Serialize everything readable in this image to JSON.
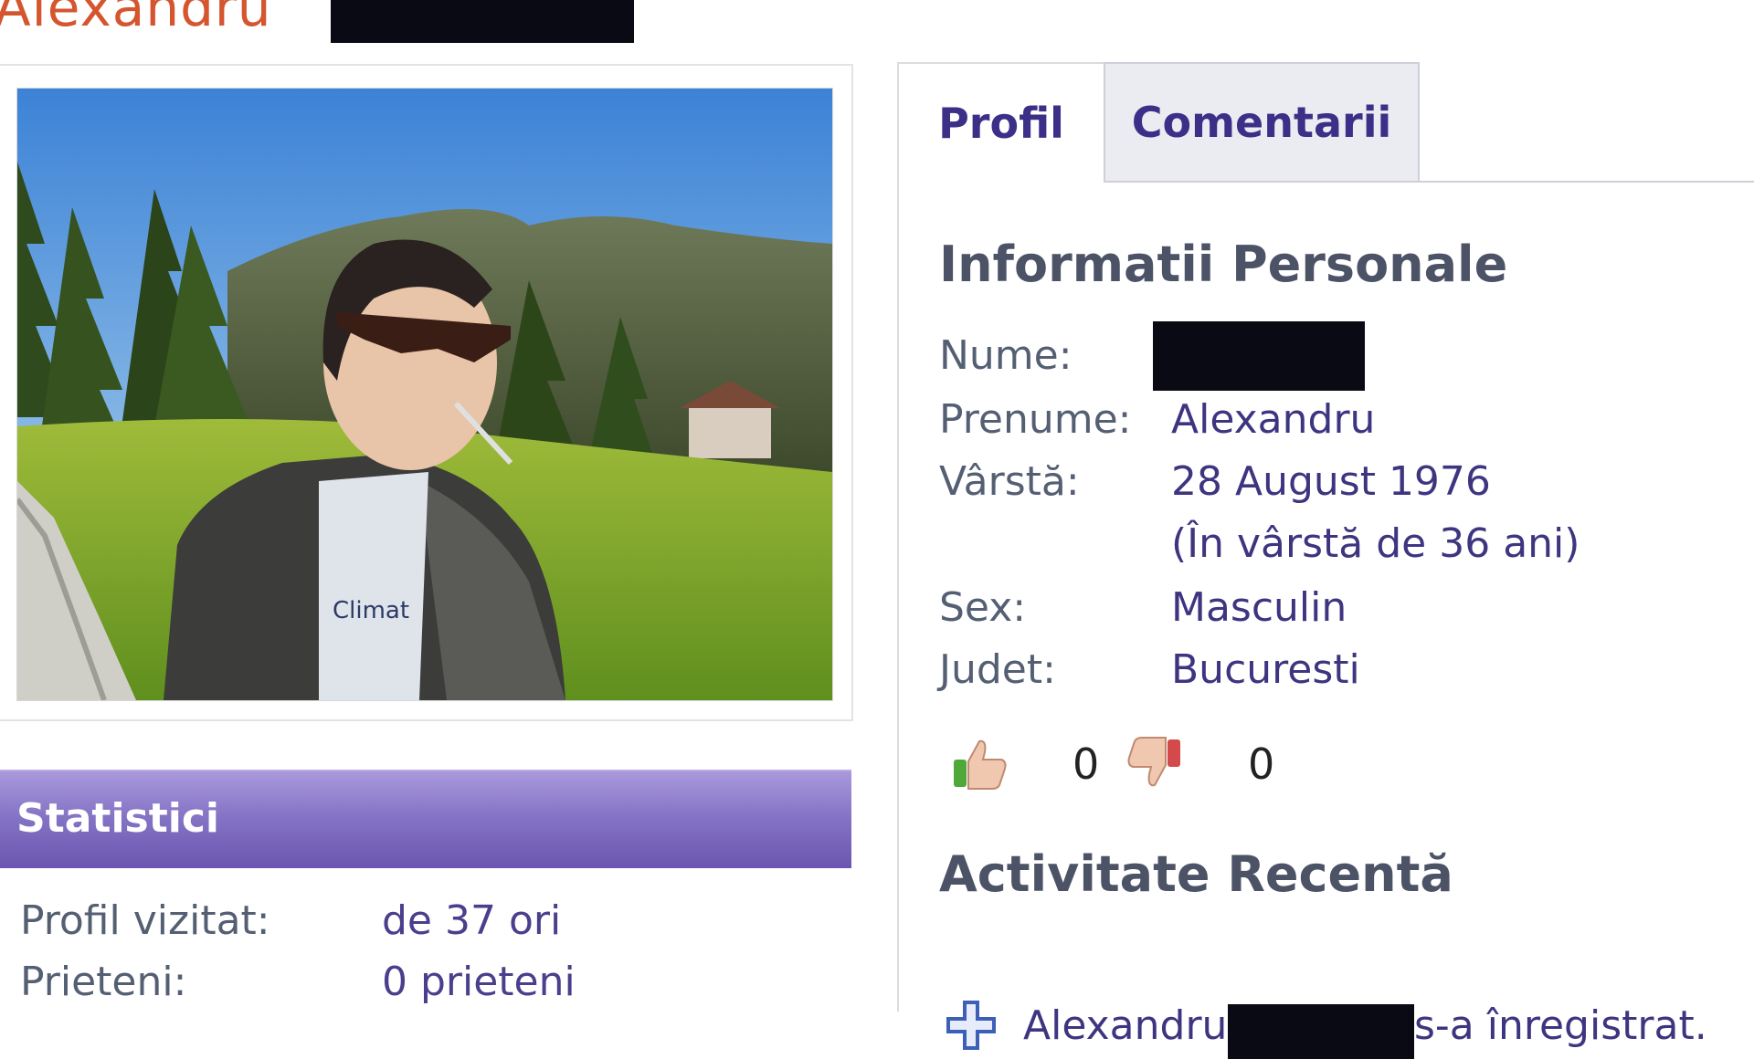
{
  "header": {
    "name": "Alexandru"
  },
  "tabs": [
    {
      "label": "Profil"
    },
    {
      "label": "Comentarii"
    }
  ],
  "personal_info": {
    "title": "Informatii Personale",
    "rows": [
      {
        "label": "Nume:",
        "value": ""
      },
      {
        "label": "Prenume:",
        "value": "Alexandru"
      },
      {
        "label": "Vârstă:",
        "value": "28 August 1976"
      },
      {
        "label": "",
        "value": "(În vârstă de 36 ani)"
      },
      {
        "label": "Sex:",
        "value": "Masculin"
      },
      {
        "label": "Judet:",
        "value": "Bucuresti"
      }
    ]
  },
  "votes": {
    "likes": "0",
    "dislikes": "0"
  },
  "recent_activity": {
    "title": "Activitate Recentă",
    "items": [
      {
        "name": "Alexandru",
        "suffix": "s-a înregistrat."
      }
    ]
  },
  "stats": {
    "title": "Statistici",
    "rows": [
      {
        "label": "Profil vizitat:",
        "value": "de 37 ori"
      },
      {
        "label": "Prieteni:",
        "value": "0 prieteni"
      }
    ]
  },
  "icons": {
    "like": "thumbs-up-icon",
    "dislike": "thumbs-down-icon",
    "activity": "plus-icon"
  },
  "colors": {
    "name_accent": "#d4552e",
    "tab_text": "#3c2f88",
    "stats_header": "#8675c6",
    "value_text": "#3d3580"
  }
}
